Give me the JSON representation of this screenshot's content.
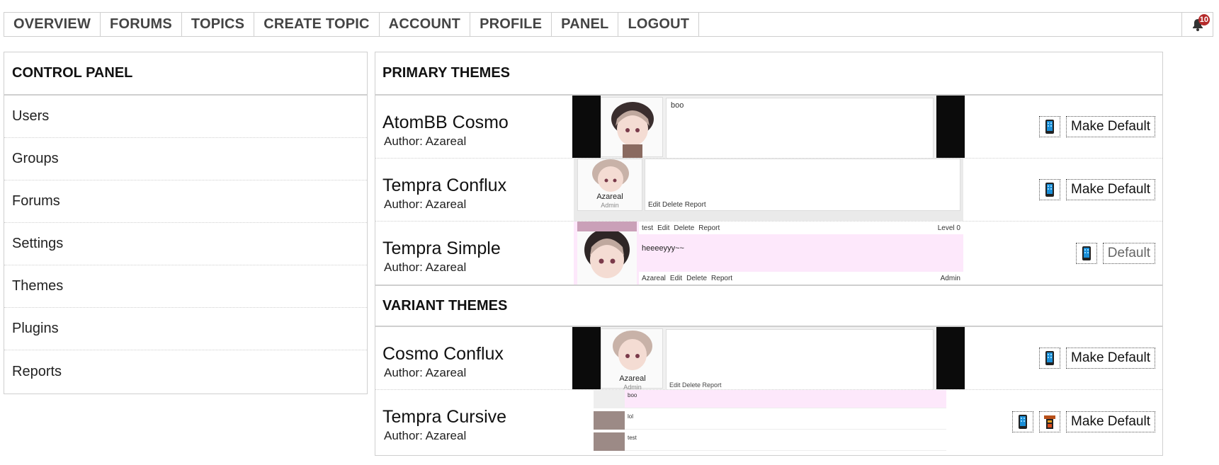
{
  "nav": {
    "items": [
      "OVERVIEW",
      "FORUMS",
      "TOPICS",
      "CREATE TOPIC",
      "ACCOUNT",
      "PROFILE",
      "PANEL",
      "LOGOUT"
    ],
    "notification_count": "10"
  },
  "control_panel": {
    "title": "CONTROL PANEL",
    "items": [
      "Users",
      "Groups",
      "Forums",
      "Settings",
      "Themes",
      "Plugins",
      "Reports"
    ]
  },
  "primary_themes": {
    "title": "PRIMARY THEMES",
    "themes": [
      {
        "name": "AtomBB Cosmo",
        "author": "Author: Azareal",
        "action": "Make Default",
        "preview_post": "boo"
      },
      {
        "name": "Tempra Conflux",
        "author": "Author: Azareal",
        "action": "Make Default",
        "preview_user": "Azareal",
        "preview_role": "Admin",
        "preview_links": "Edit  Delete  Report"
      },
      {
        "name": "Tempra Simple",
        "author": "Author: Azareal",
        "action": "Default",
        "preview_top": [
          "test",
          "Edit",
          "Delete",
          "Report",
          "Level 0"
        ],
        "preview_msg": "heeeeyyy~~",
        "preview_bot": [
          "Azareal",
          "Edit",
          "Delete",
          "Report",
          "Admin"
        ]
      }
    ]
  },
  "variant_themes": {
    "title": "VARIANT THEMES",
    "themes": [
      {
        "name": "Cosmo Conflux",
        "author": "Author: Azareal",
        "action": "Make Default",
        "preview_user": "Azareal",
        "preview_role": "Admin",
        "preview_links": "Edit  Delete  Report"
      },
      {
        "name": "Tempra Cursive",
        "author": "Author: Azareal",
        "action": "Make Default",
        "preview_lines": [
          "boo",
          "lol",
          "test"
        ]
      }
    ]
  },
  "colors": {
    "badge": "#b52a2a",
    "mobile_icon": "#1a8fd8",
    "simple_bg": "#fde8fb"
  },
  "icons": {
    "bell": "bell-icon",
    "mobile": "mobile-icon",
    "desktop": "tower-icon"
  }
}
